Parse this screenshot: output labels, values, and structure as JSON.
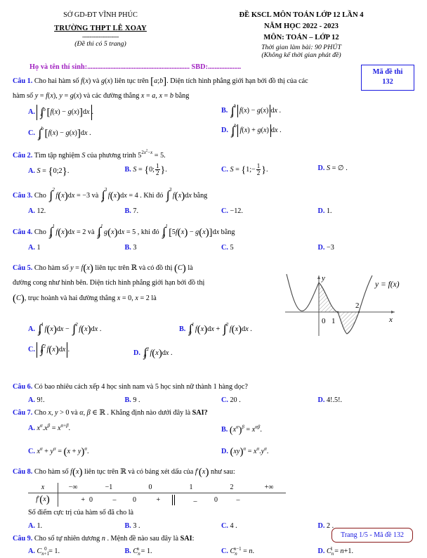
{
  "header": {
    "department": "SỞ GD-ĐT VĨNH PHÚC",
    "school": "TRƯỜNG THPT LÊ XOAY",
    "dashes": "--------------------",
    "pages_note": "(Đề thi có 5 trang)",
    "exam_title": "ĐỀ KSCL MÔN TOÁN LỚP 12 LẦN 4",
    "school_year": "NĂM HỌC 2022 - 2023",
    "subject": "MÔN: TOÁN – LỚP 12",
    "duration": "Thời gian làm bài: 90 PHÚT",
    "duration_note": "(Không kể thời gian phát đề)"
  },
  "code_box": {
    "label": "Mã đề thi",
    "code": "132"
  },
  "candidate": {
    "name_label": "Họ và tên thí sinh:",
    "name_dots": "..............................................................",
    "sbd_label": "SBD:",
    "sbd_dots": "...................."
  },
  "questions": [
    {
      "label": "Câu 1.",
      "stem_line1": "Cho hai hàm số f(x) và g(x) liên tục trên [a;b]. Diện tích hình phẳng giới hạn bởi đồ thị của các",
      "stem_line2": "hàm số y = f(x), y = g(x) và các đường thẳng x = a, x = b bằng",
      "options": [
        "A.",
        "B.",
        "C.",
        "D."
      ]
    },
    {
      "label": "Câu 2.",
      "stem": "Tìm tập nghiệm S của phương trình 5^(2x²−x) = 5.",
      "options": [
        {
          "letter": "A.",
          "text": "S = {0;2}."
        },
        {
          "letter": "B.",
          "text": "S = {0; 1/2}."
        },
        {
          "letter": "C.",
          "text": "S = {1; −1/2}."
        },
        {
          "letter": "D.",
          "text": "S = ∅."
        }
      ]
    },
    {
      "label": "Câu 3.",
      "stem": "Cho ∫₁² f(x)dx = −3 và ∫₂³ f(x)dx = 4. Khi đó ∫₁³ f(x)dx bằng",
      "integral1": {
        "lower": "1",
        "upper": "2",
        "value": "−3"
      },
      "integral2": {
        "lower": "2",
        "upper": "3",
        "value": "4"
      },
      "integral3": {
        "lower": "1",
        "upper": "3"
      },
      "options": [
        {
          "letter": "A.",
          "text": "12."
        },
        {
          "letter": "B.",
          "text": "7."
        },
        {
          "letter": "C.",
          "text": "−12."
        },
        {
          "letter": "D.",
          "text": "1."
        }
      ]
    },
    {
      "label": "Câu 4.",
      "stem": "Cho ∫₀¹ f(x)dx = 2 và ∫₀¹ g(x)dx = 5, khi đó ∫₀¹ [5f(x) − g(x)]dx bằng",
      "value_f": "2",
      "value_g": "5",
      "options": [
        {
          "letter": "A.",
          "text": "1"
        },
        {
          "letter": "B.",
          "text": "3"
        },
        {
          "letter": "C.",
          "text": "5"
        },
        {
          "letter": "D.",
          "text": "−3"
        }
      ]
    },
    {
      "label": "Câu 5.",
      "stem_line1": "Cho hàm số y = f(x) liên tục trên ℝ và có đồ thị (C) là",
      "stem_line2": "đường cong như hình bên. Diện tích hình phẳng giới hạn bởi đồ thị",
      "stem_line3": "(C), trục hoành và hai đường thẳng x = 0, x = 2 là",
      "graph_label": "y = f(x)",
      "graph_ticks": [
        "0",
        "1",
        "2"
      ],
      "graph_axis_x": "x",
      "graph_axis_y": "y",
      "options": [
        "A.",
        "B.",
        "C.",
        "D."
      ]
    },
    {
      "label": "Câu 6.",
      "stem": "Có bao nhiêu cách xếp 4 học sinh nam và 5 học sinh nữ thành 1 hàng dọc?",
      "options": [
        {
          "letter": "A.",
          "text": "9!."
        },
        {
          "letter": "B.",
          "text": "9 ."
        },
        {
          "letter": "C.",
          "text": "20 ."
        },
        {
          "letter": "D.",
          "text": "4!.5!."
        }
      ]
    },
    {
      "label": "Câu 7.",
      "stem": "Cho x, y > 0 và α, β ∈ ℝ . Khẳng định nào dưới đây là SAI?",
      "stem_bold": "SAI?",
      "options": [
        "A.",
        "B.",
        "C.",
        "D."
      ]
    },
    {
      "label": "Câu 8.",
      "stem": "Cho hàm số f(x) liên tục trên ℝ và có bảng xét dấu của f′(x) như sau:",
      "table": {
        "row1_label": "x",
        "row2_label": "f′(x)",
        "x_values": [
          "−∞",
          "−1",
          "0",
          "1",
          "2",
          "+∞"
        ],
        "sign_values": [
          "+",
          "0",
          "–",
          "0",
          "+",
          "‖",
          "–",
          "0",
          "–"
        ]
      },
      "sub_stem": "Số điểm cực trị của hàm số đã cho là",
      "options": [
        {
          "letter": "A.",
          "text": "1."
        },
        {
          "letter": "B.",
          "text": "3 ."
        },
        {
          "letter": "C.",
          "text": "4 ."
        },
        {
          "letter": "D.",
          "text": "2 ."
        }
      ]
    },
    {
      "label": "Câu 9.",
      "stem": "Cho số tự nhiên dương n . Mệnh đề nào sau đây là SAI:",
      "options": [
        "A.",
        "B.",
        "C.",
        "D."
      ]
    }
  ],
  "footer": {
    "text": "Trang 1/5 - Mã đề 132"
  },
  "colors": {
    "question_label": "#1a1ae0",
    "candidate": "#a020c0",
    "code_border": "#1a1ae0",
    "footer_border": "#8b1a1a",
    "footer_text": "#1a1ae0"
  }
}
